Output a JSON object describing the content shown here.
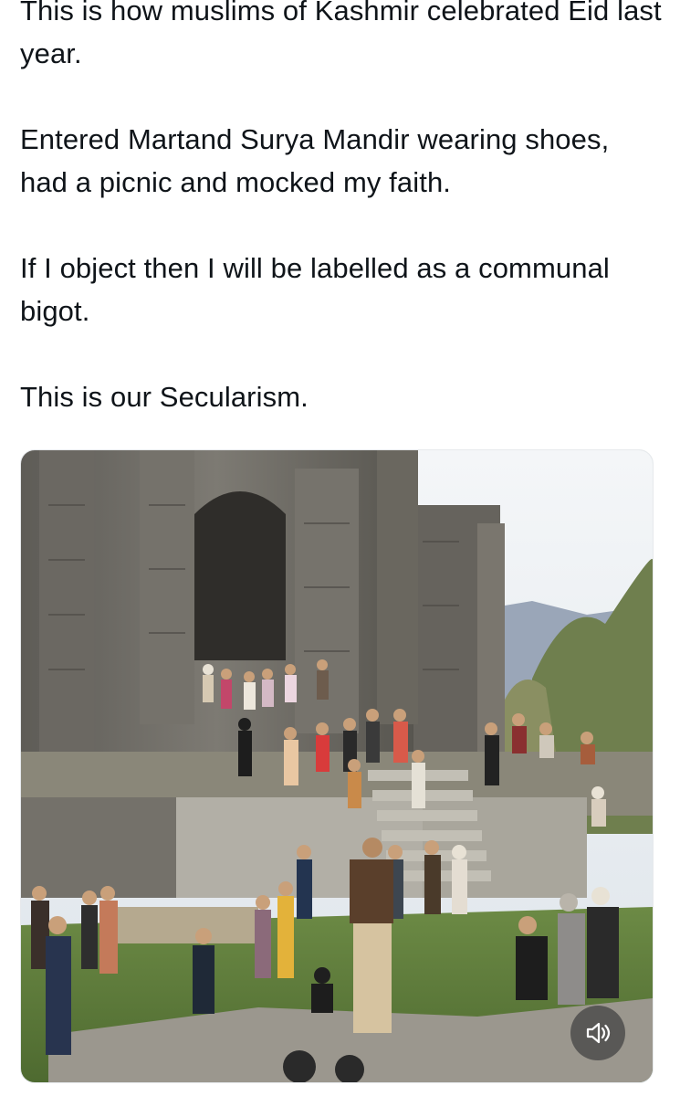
{
  "post": {
    "paragraphs": [
      "This is how muslims of Kashmir celebrated Eid last year.",
      "Entered Martand Surya Mandir wearing shoes, had a picnic and mocked my faith.",
      "If I object then I will be labelled as a communal bigot.",
      "This is our Secularism."
    ]
  },
  "media": {
    "type": "video",
    "mute_icon": "speaker-volume-icon"
  },
  "colors": {
    "text": "#0f1419",
    "background": "#ffffff",
    "stone": "#6f6c66",
    "grass": "#5d7a3c",
    "sky": "#e9eef2"
  }
}
